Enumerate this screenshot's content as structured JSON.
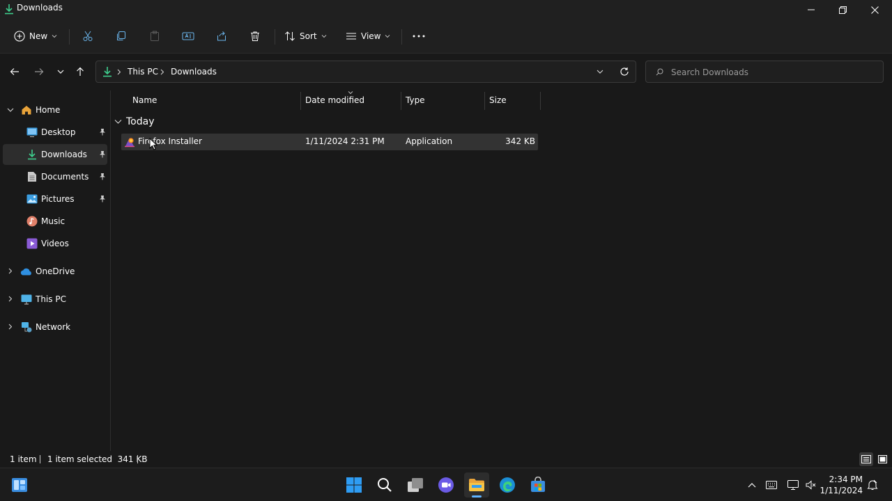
{
  "window": {
    "title": "Downloads"
  },
  "toolbar": {
    "new_label": "New",
    "sort_label": "Sort",
    "view_label": "View"
  },
  "address": {
    "crumbs": [
      "This PC",
      "Downloads"
    ]
  },
  "search": {
    "placeholder": "Search Downloads"
  },
  "sidebar": {
    "home": "Home",
    "quick_access": [
      {
        "label": "Desktop",
        "icon": "desktop-icon",
        "pinned": true
      },
      {
        "label": "Downloads",
        "icon": "download-icon",
        "pinned": true,
        "selected": true
      },
      {
        "label": "Documents",
        "icon": "documents-icon",
        "pinned": true
      },
      {
        "label": "Pictures",
        "icon": "pictures-icon",
        "pinned": true
      },
      {
        "label": "Music",
        "icon": "music-icon",
        "pinned": false
      },
      {
        "label": "Videos",
        "icon": "videos-icon",
        "pinned": false
      }
    ],
    "onedrive": "OneDrive",
    "thispc": "This PC",
    "network": "Network"
  },
  "columns": {
    "name": "Name",
    "date": "Date modified",
    "type": "Type",
    "size": "Size"
  },
  "groups": [
    {
      "label": "Today",
      "files": [
        {
          "name": "Firefox Installer",
          "date": "1/11/2024 2:31 PM",
          "type": "Application",
          "size": "342 KB",
          "icon": "firefox-installer-icon",
          "selected": true
        }
      ]
    }
  ],
  "status": {
    "count": "1 item",
    "selected": "1 item selected  341 KB"
  },
  "clock": {
    "time": "2:34 PM",
    "date": "1/11/2024"
  },
  "colors": {
    "background": "#191919",
    "chrome": "#202020",
    "accent": "#0078d4",
    "folder": "#f6c344",
    "download_green": "#3ecf8e",
    "selection": "#333333"
  }
}
